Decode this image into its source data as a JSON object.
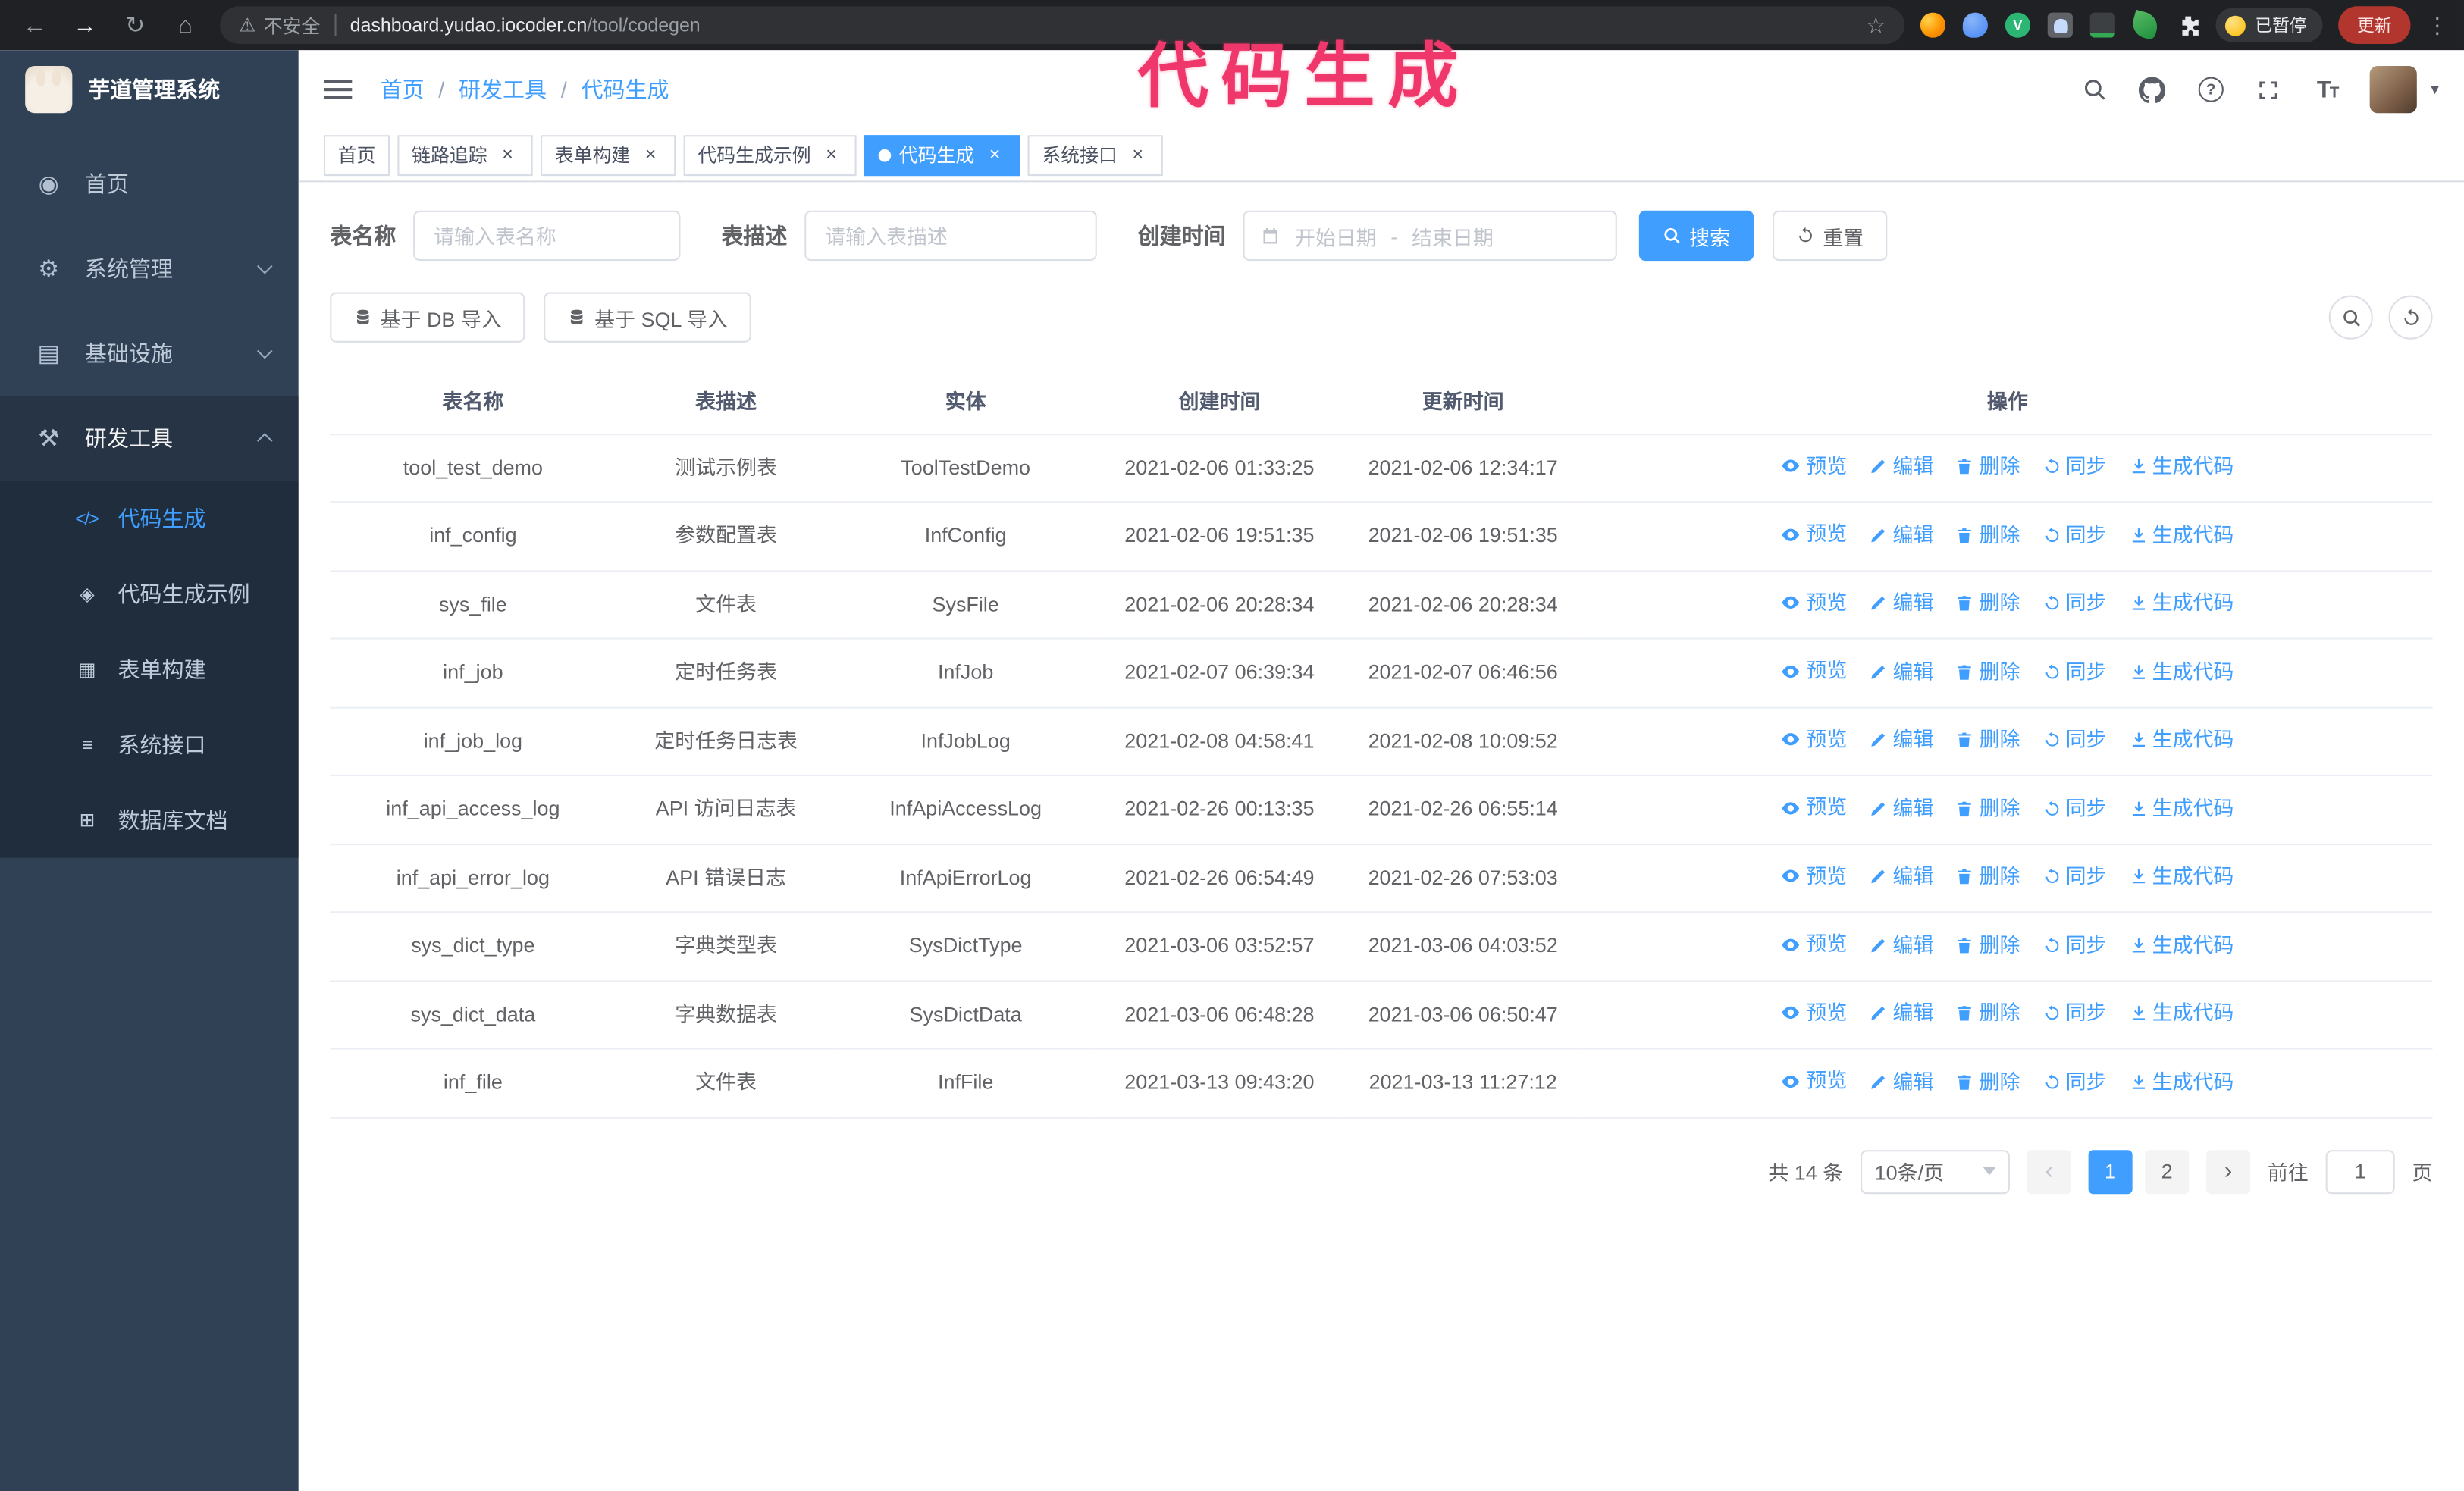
{
  "annotation": {
    "text": "代码生成"
  },
  "browser": {
    "nav_icons": [
      {
        "name": "back-icon",
        "glyph": "←"
      },
      {
        "name": "forward-icon",
        "glyph": "→"
      },
      {
        "name": "reload-icon",
        "glyph": "↻"
      },
      {
        "name": "home-icon",
        "glyph": "⌂"
      }
    ],
    "security_text": "不安全",
    "url_host": "dashboard.yudao.iocoder.cn",
    "url_path": "/tool/codegen",
    "extension_icons": [
      "firefox-extension-icon",
      "colorpick-extension-icon",
      "vue-devtools-extension-icon",
      "contacts-extension-icon",
      "screenshot-extension-icon",
      "leaf-extension-icon",
      "extensions-puzzle-icon"
    ],
    "paused_badge": "已暂停",
    "update_button": "更新"
  },
  "sidebar": {
    "title": "芋道管理系统",
    "menu": [
      {
        "label": "首页",
        "icon": "dashboard-icon",
        "expandable": false,
        "expanded": false
      },
      {
        "label": "系统管理",
        "icon": "gear-icon",
        "expandable": true,
        "expanded": false
      },
      {
        "label": "基础设施",
        "icon": "infrastructure-icon",
        "expandable": true,
        "expanded": false
      },
      {
        "label": "研发工具",
        "icon": "tools-icon",
        "expandable": true,
        "expanded": true
      }
    ],
    "submenu": [
      {
        "label": "代码生成",
        "icon": "code-icon",
        "active": true
      },
      {
        "label": "代码生成示例",
        "icon": "example-icon",
        "active": false
      },
      {
        "label": "表单构建",
        "icon": "form-icon",
        "active": false
      },
      {
        "label": "系统接口",
        "icon": "api-icon",
        "active": false
      },
      {
        "label": "数据库文档",
        "icon": "database-icon",
        "active": false
      }
    ]
  },
  "header": {
    "breadcrumb": [
      "首页",
      "研发工具",
      "代码生成"
    ],
    "right_icons": [
      "search-icon",
      "github-icon",
      "question-icon",
      "fullscreen-icon",
      "font-size-icon"
    ]
  },
  "tabs": [
    {
      "label": "首页",
      "closable": false,
      "active": false
    },
    {
      "label": "链路追踪",
      "closable": true,
      "active": false
    },
    {
      "label": "表单构建",
      "closable": true,
      "active": false
    },
    {
      "label": "代码生成示例",
      "closable": true,
      "active": false
    },
    {
      "label": "代码生成",
      "closable": true,
      "active": true
    },
    {
      "label": "系统接口",
      "closable": true,
      "active": false
    }
  ],
  "filters": {
    "table_name_label": "表名称",
    "table_name_placeholder": "请输入表名称",
    "table_desc_label": "表描述",
    "table_desc_placeholder": "请输入表描述",
    "create_time_label": "创建时间",
    "start_date_placeholder": "开始日期",
    "range_separator": "-",
    "end_date_placeholder": "结束日期",
    "search_button": "搜索",
    "reset_button": "重置"
  },
  "toolbar": {
    "import_db_label": "基于 DB 导入",
    "import_sql_label": "基于 SQL 导入"
  },
  "table": {
    "columns": [
      "表名称",
      "表描述",
      "实体",
      "创建时间",
      "更新时间",
      "操作"
    ],
    "row_actions": [
      {
        "name": "preview",
        "label": "预览",
        "icon": "eye-icon"
      },
      {
        "name": "edit",
        "label": "编辑",
        "icon": "edit-icon"
      },
      {
        "name": "delete",
        "label": "删除",
        "icon": "delete-icon"
      },
      {
        "name": "sync",
        "label": "同步",
        "icon": "sync-icon"
      },
      {
        "name": "generate-code",
        "label": "生成代码",
        "icon": "download-icon"
      }
    ],
    "rows": [
      {
        "name": "tool_test_demo",
        "desc": "测试示例表",
        "entity": "ToolTestDemo",
        "created": "2021-02-06 01:33:25",
        "updated": "2021-02-06 12:34:17"
      },
      {
        "name": "inf_config",
        "desc": "参数配置表",
        "entity": "InfConfig",
        "created": "2021-02-06 19:51:35",
        "updated": "2021-02-06 19:51:35"
      },
      {
        "name": "sys_file",
        "desc": "文件表",
        "entity": "SysFile",
        "created": "2021-02-06 20:28:34",
        "updated": "2021-02-06 20:28:34"
      },
      {
        "name": "inf_job",
        "desc": "定时任务表",
        "entity": "InfJob",
        "created": "2021-02-07 06:39:34",
        "updated": "2021-02-07 06:46:56"
      },
      {
        "name": "inf_job_log",
        "desc": "定时任务日志表",
        "entity": "InfJobLog",
        "created": "2021-02-08 04:58:41",
        "updated": "2021-02-08 10:09:52"
      },
      {
        "name": "inf_api_access_log",
        "desc": "API 访问日志表",
        "entity": "InfApiAccessLog",
        "created": "2021-02-26 00:13:35",
        "updated": "2021-02-26 06:55:14"
      },
      {
        "name": "inf_api_error_log",
        "desc": "API 错误日志",
        "entity": "InfApiErrorLog",
        "created": "2021-02-26 06:54:49",
        "updated": "2021-02-26 07:53:03"
      },
      {
        "name": "sys_dict_type",
        "desc": "字典类型表",
        "entity": "SysDictType",
        "created": "2021-03-06 03:52:57",
        "updated": "2021-03-06 04:03:52"
      },
      {
        "name": "sys_dict_data",
        "desc": "字典数据表",
        "entity": "SysDictData",
        "created": "2021-03-06 06:48:28",
        "updated": "2021-03-06 06:50:47"
      },
      {
        "name": "inf_file",
        "desc": "文件表",
        "entity": "InfFile",
        "created": "2021-03-13 09:43:20",
        "updated": "2021-03-13 11:27:12"
      }
    ]
  },
  "pagination": {
    "total_text": "共 14 条",
    "page_size_text": "10条/页",
    "pages": [
      "1",
      "2"
    ],
    "active_page": "1",
    "goto_text": "前往",
    "goto_value": "1",
    "unit_text": "页"
  }
}
